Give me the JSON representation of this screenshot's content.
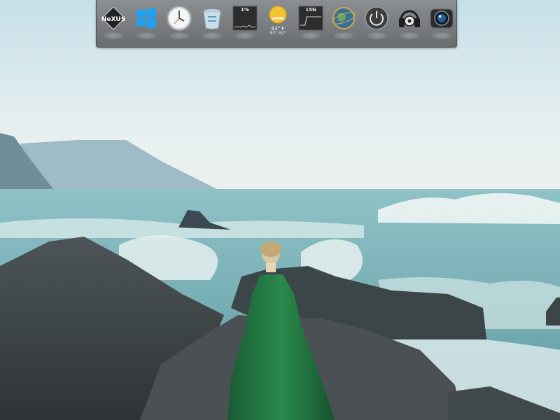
{
  "dock": {
    "items": [
      {
        "name": "nexus-logo-icon",
        "label": "NeXUS"
      },
      {
        "name": "windows-start-icon"
      },
      {
        "name": "clock-icon"
      },
      {
        "name": "recycle-bin-icon"
      },
      {
        "name": "cpu-meter-icon",
        "value_label": "1%",
        "level": 0.01
      },
      {
        "name": "weather-icon",
        "temp": "63° F",
        "range": "83° 62°"
      },
      {
        "name": "memory-meter-icon",
        "value_label": "15G"
      },
      {
        "name": "internet-globe-icon"
      },
      {
        "name": "power-icon"
      },
      {
        "name": "media-headphones-icon"
      },
      {
        "name": "camera-icon"
      }
    ]
  },
  "colors": {
    "dock_bg": "#7b7e81",
    "sky": "#dfeef2",
    "sea": "#6fa6ad",
    "dress": "#1f6b3c",
    "rock": "#3d4447"
  }
}
